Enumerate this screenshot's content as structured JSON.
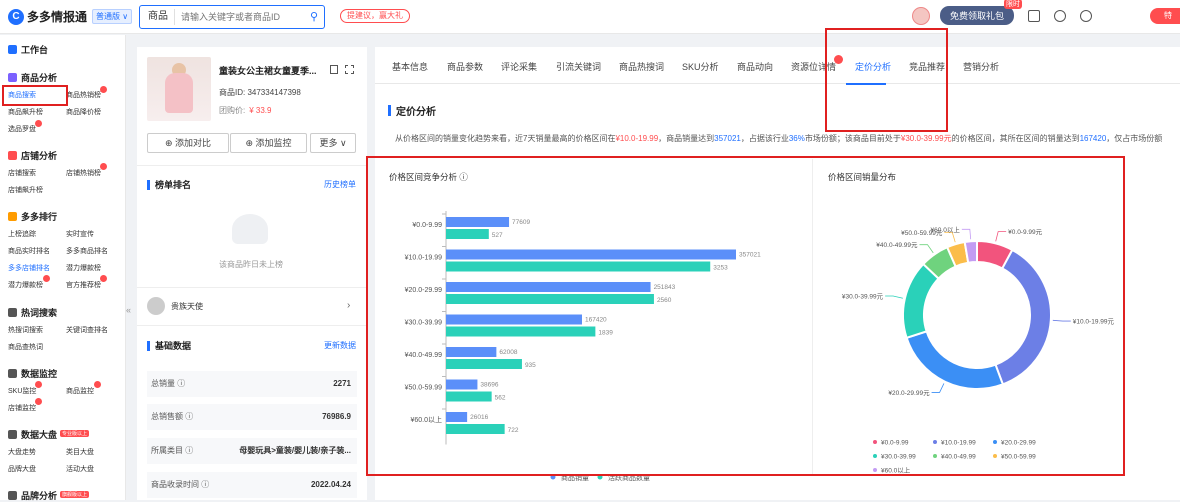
{
  "header": {
    "logo_mark": "C",
    "logo_text": "多多情报通",
    "version": "普通版 ∨",
    "search_category": "商品",
    "search_placeholder": "请输入关键字或者商品ID",
    "suggest": "提建议，赢大礼",
    "gift": "免费领取礼包",
    "gift_badge": "限时",
    "red_btn": "特"
  },
  "sidebar": {
    "s1": "工作台",
    "s2": "商品分析",
    "items_goods": [
      "商品搜索",
      "商品热销榜",
      "商品飙升榜",
      "商品降价榜",
      "选品罗盘"
    ],
    "s3": "店铺分析",
    "items_shop": [
      "店铺搜索",
      "店铺热销榜",
      "店铺飙升榜"
    ],
    "s4": "多多排行",
    "items_rank": [
      "上榜追踪",
      "实时宣传",
      "商品实时排名",
      "多多商品排名",
      "多多店铺排名",
      "潜力爆款榜",
      "官方推荐榜",
      "潜力爆款榜"
    ],
    "s5": "热词搜索",
    "items_words": [
      "热搜词搜索",
      "关键词查排名",
      "商品查热词"
    ],
    "s6": "数据监控",
    "items_monitor": [
      "SKU监控",
      "商品监控",
      "店铺监控"
    ],
    "s7": "数据大盘",
    "s7_tag": "专业版以上",
    "items_market": [
      "大盘走势",
      "类目大盘",
      "品牌大盘",
      "活动大盘"
    ],
    "s8": "品牌分析",
    "s8_tag": "旗舰版以上"
  },
  "product": {
    "title": "童装女公主裙女童夏季...",
    "id": "商品ID: 347334147398",
    "price_label": "团购价:",
    "price": "¥ 33.9",
    "btn_compare": "⊕ 添加对比",
    "btn_monitor": "⊕ 添加监控",
    "btn_more": "更多 ∨"
  },
  "ranking": {
    "title": "榜单排名",
    "link": "历史榜单",
    "empty": "该商品昨日未上榜"
  },
  "shop": {
    "name": "贵族天使"
  },
  "basic": {
    "title": "基础数据",
    "link": "更新数据",
    "rows": [
      {
        "label": "总销量 ⓘ",
        "value": "2271"
      },
      {
        "label": "总销售额 ⓘ",
        "value": "76986.9"
      },
      {
        "label": "所属类目 ⓘ",
        "value": "母婴玩具>童装/婴儿装/亲子装..."
      },
      {
        "label": "商品收录时间 ⓘ",
        "value": "2022.04.24"
      }
    ]
  },
  "tabs": [
    "基本信息",
    "商品参数",
    "评论采集",
    "引流关键词",
    "商品热搜词",
    "SKU分析",
    "商品动向",
    "资源位详情",
    "定价分析",
    "竞品推荐",
    "营销分析"
  ],
  "pricing": {
    "title": "定价分析",
    "summary": {
      "p1": "从价格区间的销量变化趋势来看，近7天销量最高的价格区间在",
      "r1": "¥10.0-19.99",
      "p2": "，商品销量达到",
      "b1": "357021",
      "p3": "，占据该行业",
      "b2": "36%",
      "p4": "市场份额；该商品目前处于",
      "r2": "¥30.0-39.99元",
      "p5": "的价格区间，其所在区间的销量达到",
      "b3": "167420",
      "p6": "，仅占市场份额"
    },
    "bar_title": "价格区间竞争分析 ⓘ",
    "pie_title": "价格区间销量分布"
  },
  "chart_data": [
    {
      "type": "bar",
      "orientation": "horizontal",
      "categories": [
        "¥0.0-9.99",
        "¥10.0-19.99",
        "¥20.0-29.99",
        "¥30.0-39.99",
        "¥40.0-49.99",
        "¥50.0-59.99",
        "¥60.0以上"
      ],
      "series": [
        {
          "name": "商品销量",
          "color": "#5b8ff9",
          "values": [
            77609,
            357021,
            251843,
            167420,
            62008,
            38696,
            26016
          ]
        },
        {
          "name": "活跃商品数量",
          "color": "#2ad1b9",
          "values": [
            527,
            3253,
            2560,
            1839,
            935,
            562,
            722
          ]
        }
      ]
    },
    {
      "type": "pie",
      "donut": true,
      "labels": [
        "¥0.0-9.99元",
        "¥10.0-19.99元",
        "¥20.0-29.99元",
        "¥30.0-39.99元",
        "¥40.0-49.99元",
        "¥50.0-59.99元",
        "¥60.0以上"
      ],
      "values": [
        77609,
        357021,
        251843,
        167420,
        62008,
        38696,
        26016
      ],
      "colors": [
        "#f2547d",
        "#6c7fe6",
        "#3b8ff5",
        "#2ad1b9",
        "#6fd37e",
        "#fbbd4a",
        "#c39cf3"
      ],
      "legend": [
        "¥0.0-9.99",
        "¥10.0-19.99",
        "¥20.0-29.99",
        "¥30.0-39.99",
        "¥40.0-49.99",
        "¥50.0-59.99",
        "¥60.0以上"
      ]
    }
  ]
}
